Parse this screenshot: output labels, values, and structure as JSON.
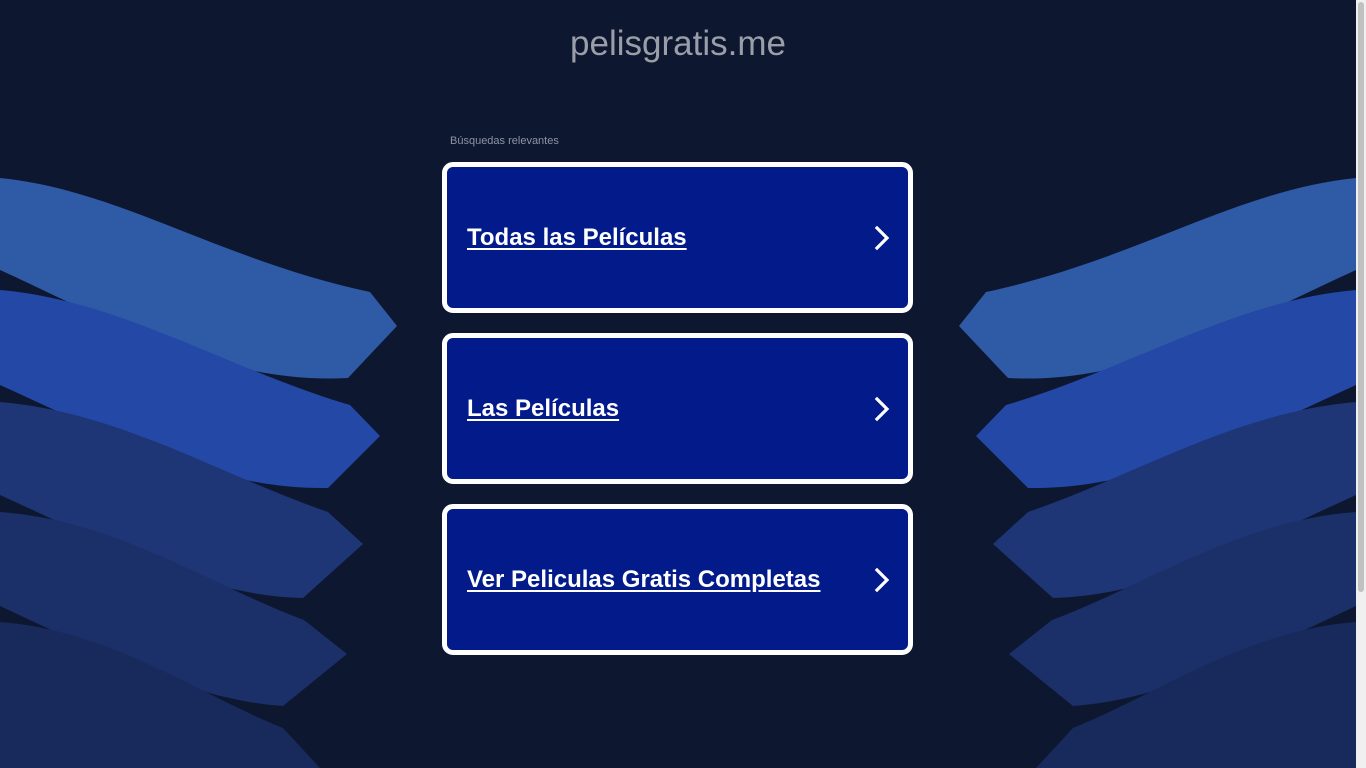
{
  "site": {
    "title": "pelisgratis.me"
  },
  "related": {
    "label": "Búsquedas relevantes",
    "items": [
      {
        "label": "Todas las Películas",
        "icon": "chevron-right-icon"
      },
      {
        "label": "Las Películas",
        "icon": "chevron-right-icon"
      },
      {
        "label": "Ver Peliculas Gratis Completas",
        "icon": "chevron-right-icon"
      }
    ]
  },
  "colors": {
    "background": "#0e1730",
    "ad_fill": "#021a8a",
    "ad_border": "#ffffff",
    "title_text": "#9a9ea8",
    "wave_light": "#2f5aa6",
    "wave_mid": "#2343a0",
    "wave_dark": "#1b2e6a"
  }
}
